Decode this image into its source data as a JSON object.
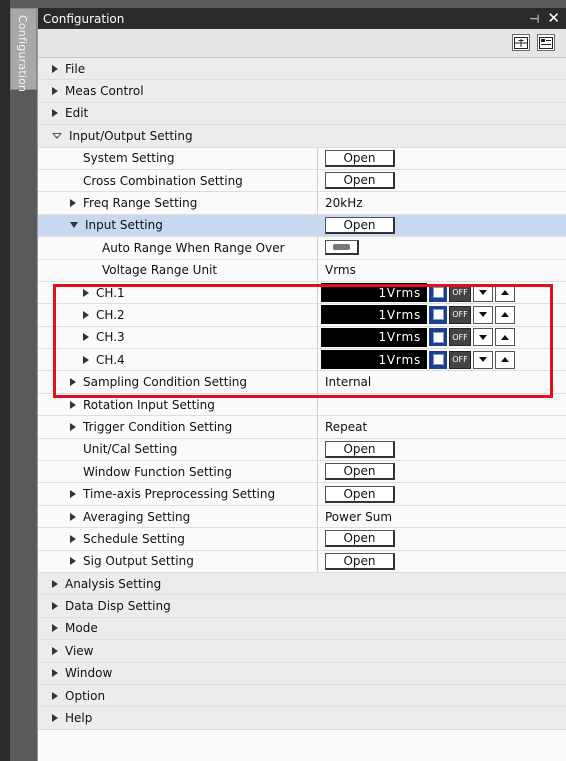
{
  "sidebar_tab": {
    "label": "Configuration"
  },
  "window": {
    "title": "Configuration",
    "pin_glyph": "⊣",
    "close_glyph": "✕"
  },
  "toolbar": {
    "buttons": [
      "expand-icon",
      "collapse-icon"
    ]
  },
  "rows": [
    {
      "type": "cat",
      "arrow": "right",
      "indent": 14,
      "label": "File"
    },
    {
      "type": "cat",
      "arrow": "right",
      "indent": 14,
      "label": "Meas Control"
    },
    {
      "type": "cat",
      "arrow": "right",
      "indent": 14,
      "label": "Edit"
    },
    {
      "type": "cat",
      "arrow": "open",
      "indent": 14,
      "label": "Input/Output Setting"
    },
    {
      "type": "prop",
      "arrow": "none",
      "indent": 45,
      "label": "System Setting",
      "value": {
        "kind": "button",
        "text": "Open"
      }
    },
    {
      "type": "prop",
      "arrow": "none",
      "indent": 45,
      "label": "Cross Combination Setting",
      "value": {
        "kind": "button",
        "text": "Open"
      }
    },
    {
      "type": "prop",
      "arrow": "right",
      "indent": 32,
      "label": "Freq Range Setting",
      "value": {
        "kind": "text",
        "text": "20kHz"
      }
    },
    {
      "type": "prop",
      "arrow": "down",
      "indent": 32,
      "label": "Input Setting",
      "selected": true,
      "value": {
        "kind": "button",
        "text": "Open"
      }
    },
    {
      "type": "prop",
      "arrow": "none",
      "indent": 64,
      "label": "Auto Range When Range Over",
      "value": {
        "kind": "toggle"
      }
    },
    {
      "type": "prop",
      "arrow": "none",
      "indent": 64,
      "label": "Voltage Range Unit",
      "value": {
        "kind": "text",
        "text": "Vrms"
      }
    },
    {
      "type": "prop",
      "arrow": "right",
      "indent": 45,
      "label": "CH.1",
      "value": {
        "kind": "channel",
        "text": "1Vrms",
        "off": "OFF"
      }
    },
    {
      "type": "prop",
      "arrow": "right",
      "indent": 45,
      "label": "CH.2",
      "value": {
        "kind": "channel",
        "text": "1Vrms",
        "off": "OFF"
      }
    },
    {
      "type": "prop",
      "arrow": "right",
      "indent": 45,
      "label": "CH.3",
      "value": {
        "kind": "channel",
        "text": "1Vrms",
        "off": "OFF"
      }
    },
    {
      "type": "prop",
      "arrow": "right",
      "indent": 45,
      "label": "CH.4",
      "value": {
        "kind": "channel",
        "text": "1Vrms",
        "off": "OFF"
      }
    },
    {
      "type": "prop",
      "arrow": "right",
      "indent": 32,
      "label": "Sampling Condition Setting",
      "value": {
        "kind": "text",
        "text": "Internal"
      }
    },
    {
      "type": "prop",
      "arrow": "right",
      "indent": 32,
      "label": "Rotation Input Setting",
      "value": {
        "kind": "empty"
      }
    },
    {
      "type": "prop",
      "arrow": "right",
      "indent": 32,
      "label": "Trigger Condition Setting",
      "value": {
        "kind": "text",
        "text": "Repeat"
      }
    },
    {
      "type": "prop",
      "arrow": "none",
      "indent": 45,
      "label": "Unit/Cal Setting",
      "value": {
        "kind": "button",
        "text": "Open"
      }
    },
    {
      "type": "prop",
      "arrow": "none",
      "indent": 45,
      "label": "Window Function Setting",
      "value": {
        "kind": "button",
        "text": "Open"
      }
    },
    {
      "type": "prop",
      "arrow": "right",
      "indent": 32,
      "label": "Time-axis Preprocessing Setting",
      "value": {
        "kind": "button",
        "text": "Open"
      }
    },
    {
      "type": "prop",
      "arrow": "right",
      "indent": 32,
      "label": "Averaging Setting",
      "value": {
        "kind": "text",
        "text": "Power Sum"
      }
    },
    {
      "type": "prop",
      "arrow": "right",
      "indent": 32,
      "label": "Schedule Setting",
      "value": {
        "kind": "button",
        "text": "Open"
      }
    },
    {
      "type": "prop",
      "arrow": "right",
      "indent": 32,
      "label": "Sig Output Setting",
      "value": {
        "kind": "button",
        "text": "Open"
      }
    },
    {
      "type": "cat",
      "arrow": "right",
      "indent": 14,
      "label": "Analysis Setting"
    },
    {
      "type": "cat",
      "arrow": "right",
      "indent": 14,
      "label": "Data Disp Setting"
    },
    {
      "type": "cat",
      "arrow": "right",
      "indent": 14,
      "label": "Mode"
    },
    {
      "type": "cat",
      "arrow": "right",
      "indent": 14,
      "label": "View"
    },
    {
      "type": "cat",
      "arrow": "right",
      "indent": 14,
      "label": "Window"
    },
    {
      "type": "cat",
      "arrow": "right",
      "indent": 14,
      "label": "Option"
    },
    {
      "type": "cat",
      "arrow": "right",
      "indent": 14,
      "label": "Help"
    }
  ],
  "colors": {
    "selected_row": "#c6d9f1",
    "highlight_border": "#e3101b",
    "titlebar": "#2a2a2a"
  }
}
